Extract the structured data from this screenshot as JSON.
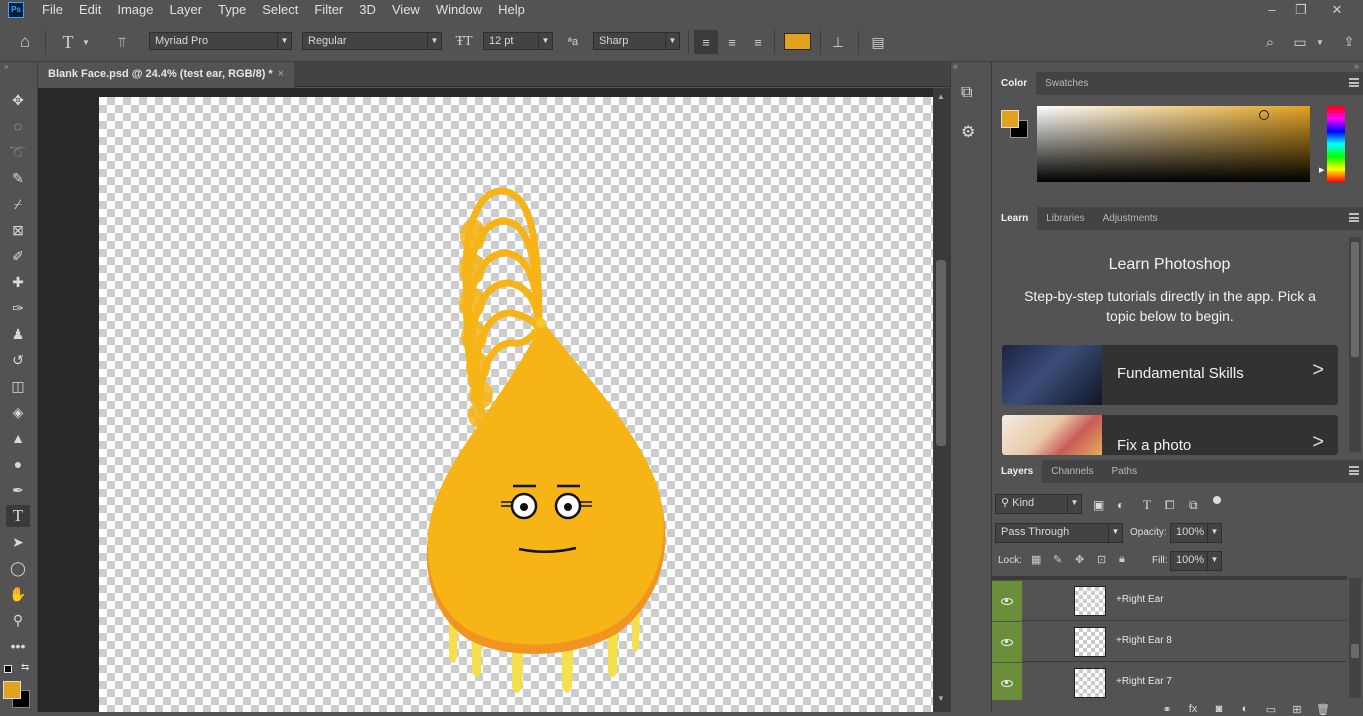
{
  "menubar": {
    "logo": "Ps",
    "items": [
      "File",
      "Edit",
      "Image",
      "Layer",
      "Type",
      "Select",
      "Filter",
      "3D",
      "View",
      "Window",
      "Help"
    ]
  },
  "options": {
    "font_family": "Myriad Pro",
    "font_style": "Regular",
    "font_size": "12 pt",
    "antialias": "Sharp",
    "color": "#e2a220"
  },
  "document": {
    "tab_title": "Blank Face.psd @ 24.4% (test ear, RGB/8) *",
    "close": "×"
  },
  "colors": {
    "accent": "#e2a220",
    "creature": "#f6b416",
    "foreground": "#e2a220",
    "background": "#000000"
  },
  "color_panel": {
    "tabs": [
      "Color",
      "Swatches"
    ]
  },
  "learn_panel": {
    "tabs": [
      "Learn",
      "Libraries",
      "Adjustments"
    ],
    "title": "Learn Photoshop",
    "description": "Step-by-step tutorials directly in the app. Pick a topic below to begin.",
    "cards": [
      {
        "title": "Fundamental Skills",
        "arrow": ">"
      },
      {
        "title": "Fix a photo",
        "arrow": ">"
      }
    ]
  },
  "layers_panel": {
    "tabs": [
      "Layers",
      "Channels",
      "Paths"
    ],
    "filter_kind": "Kind",
    "blend_mode": "Pass Through",
    "opacity_label": "Opacity:",
    "opacity": "100%",
    "lock_label": "Lock:",
    "fill_label": "Fill:",
    "fill": "100%",
    "layers": [
      {
        "name": "+Right Ear"
      },
      {
        "name": "+Right Ear 8"
      },
      {
        "name": "+Right Ear 7"
      }
    ]
  }
}
